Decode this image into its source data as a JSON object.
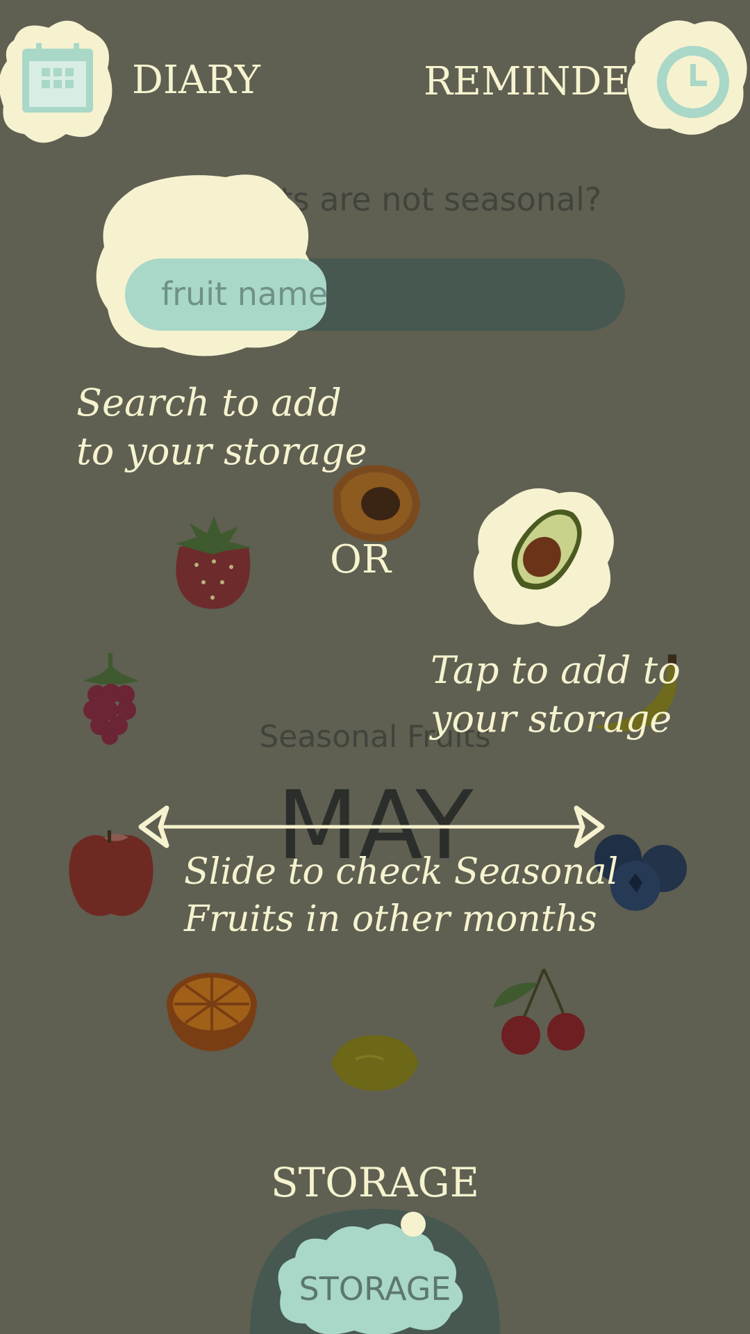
{
  "header": {
    "diary_label": "DIARY",
    "reminder_label": "REMINDER"
  },
  "search": {
    "prompt": "Your fruits are not seasonal?",
    "placeholder": "fruit name"
  },
  "tutorial": {
    "search_hint_line1": "Search to add",
    "search_hint_line2": "to your storage",
    "or_label": "OR",
    "tap_hint_line1": "Tap to add to",
    "tap_hint_line2": "your storage",
    "slide_hint_line1": "Slide to check Seasonal",
    "slide_hint_line2": "Fruits in other months"
  },
  "seasonal": {
    "title": "Seasonal Fruits",
    "month": "MAY"
  },
  "fruits": [
    "strawberry",
    "peach",
    "avocado",
    "raspberry",
    "banana",
    "apple",
    "blueberries",
    "orange",
    "lemon",
    "cherries"
  ],
  "storage": {
    "overlay_label": "STORAGE",
    "button_label": "STORAGE"
  },
  "colors": {
    "background": "#5f5f52",
    "cream": "#f6f2cf",
    "mint": "#a9d7c8",
    "dark_teal": "#465850"
  }
}
